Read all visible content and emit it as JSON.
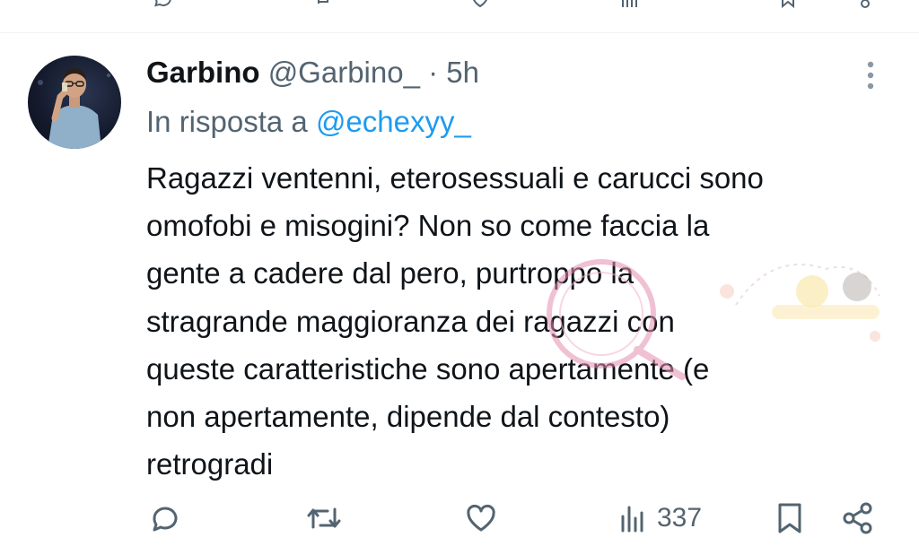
{
  "tweet": {
    "display_name": "Garbino",
    "handle": "@Garbino_",
    "separator": "·",
    "time": "5h",
    "reply_prefix": "In risposta a",
    "reply_mention": "@echexyy_",
    "text_lines": [
      "Ragazzi ventenni, eterosessuali e carucci sono",
      "omofobi e misogini? Non so come faccia la",
      "gente a cadere dal pero, purtroppo la",
      "stragrande maggioranza dei ragazzi con",
      "queste caratteristiche sono apertamente (e",
      "non apertamente, dipende dal contesto)",
      "retrogradi"
    ],
    "views": "337"
  },
  "colors": {
    "primary_text": "#0f1419",
    "secondary_text": "#536471",
    "link": "#1d9bf0",
    "divider": "#eff3f4"
  },
  "icons": {
    "reply": "speech-bubble-icon",
    "retweet": "retweet-icon",
    "like": "heart-icon",
    "views": "bar-chart-icon",
    "bookmark": "bookmark-icon",
    "share": "share-icon",
    "more": "more-vertical-icon"
  }
}
